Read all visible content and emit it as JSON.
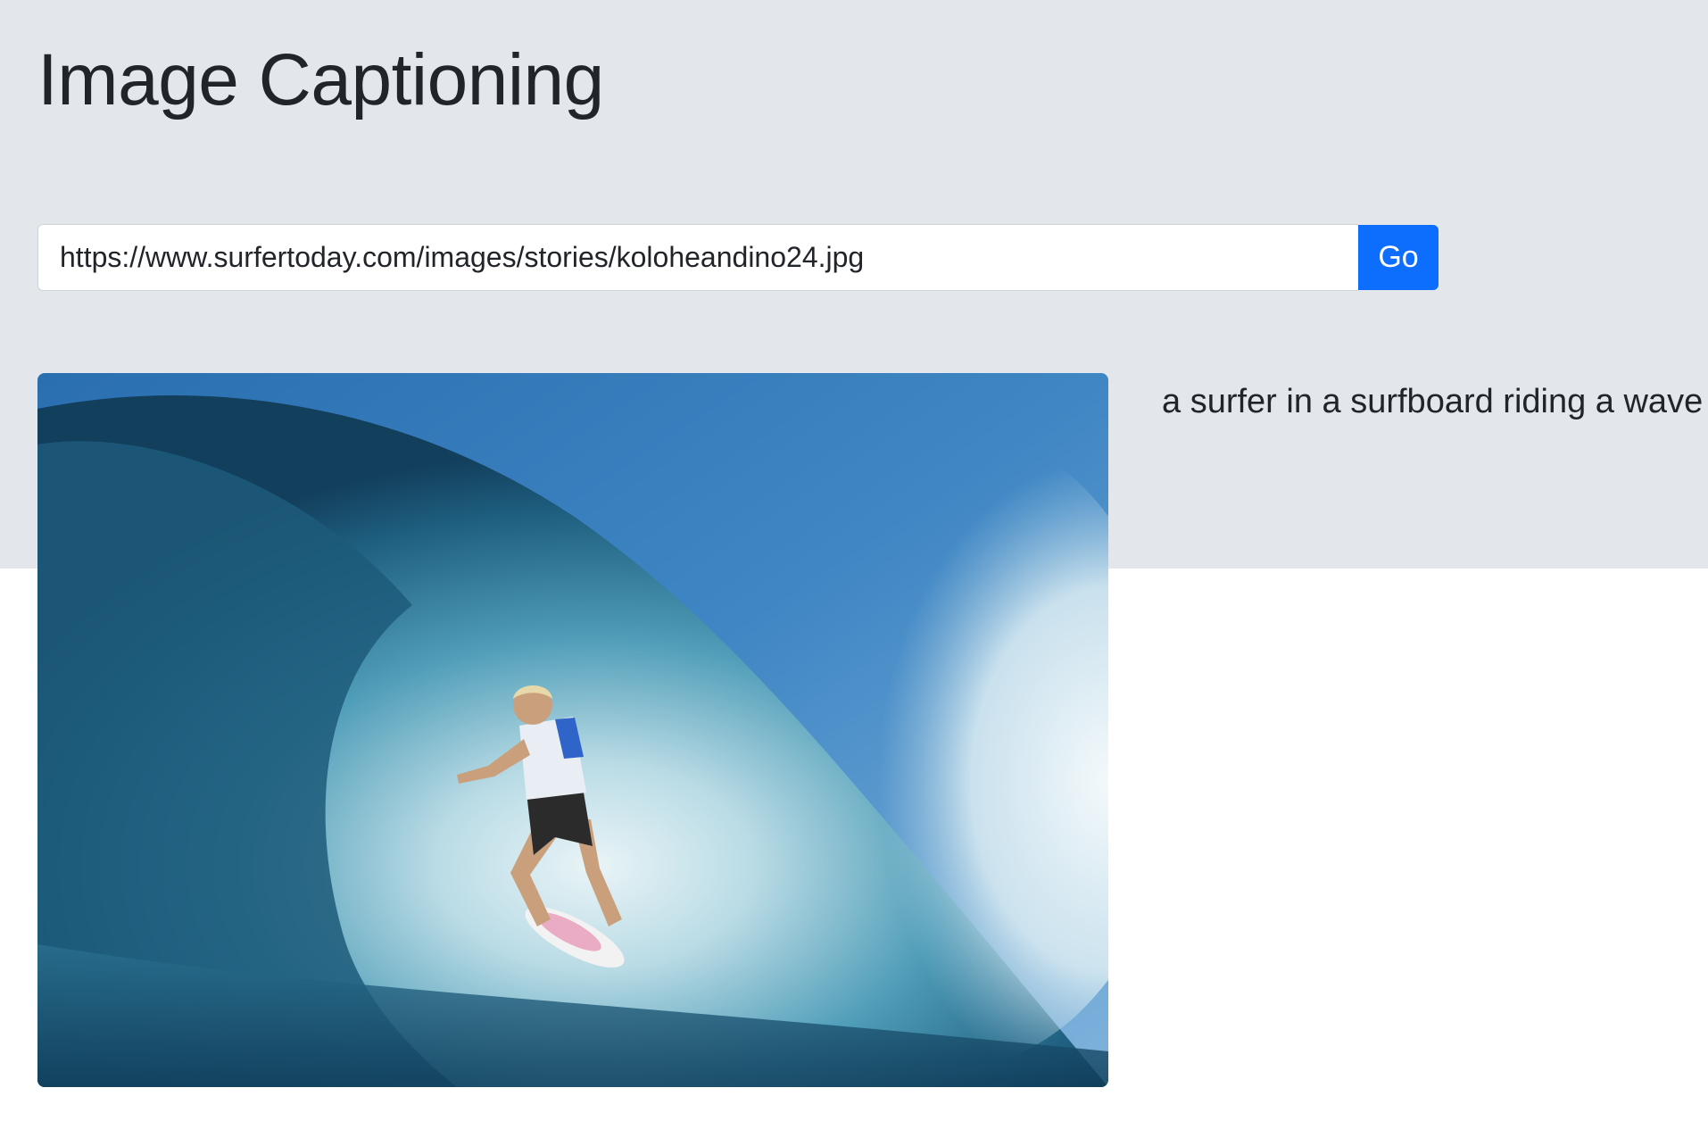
{
  "page": {
    "title": "Image Captioning"
  },
  "form": {
    "url_value": "https://www.surfertoday.com/images/stories/koloheandino24.jpg",
    "go_label": "Go"
  },
  "result": {
    "image_subject": "surfer riding inside a barreling wave",
    "caption": "a surfer in a surfboard riding a wave"
  },
  "colors": {
    "hero_background": "#e3e6eb",
    "button_primary": "#0d6efd"
  }
}
